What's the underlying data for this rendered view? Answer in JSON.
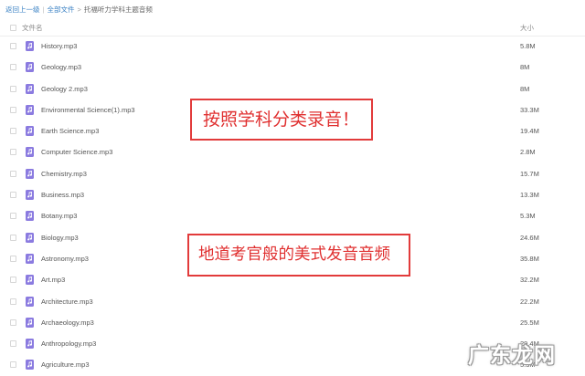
{
  "breadcrumb": {
    "back": "返回上一级",
    "separator": "|",
    "all_files": "全部文件",
    "arrow": ">",
    "current": "托福听力学科主题音频"
  },
  "header": {
    "name_label": "文件名",
    "size_label": "大小"
  },
  "files": [
    {
      "name": "History.mp3",
      "size": "5.8M",
      "icon": "audio-file-icon"
    },
    {
      "name": "Geology.mp3",
      "size": "8M",
      "icon": "audio-file-icon"
    },
    {
      "name": "Geology 2.mp3",
      "size": "8M",
      "icon": "audio-file-icon"
    },
    {
      "name": "Environmental Science(1).mp3",
      "size": "33.3M",
      "icon": "audio-file-icon"
    },
    {
      "name": "Earth Science.mp3",
      "size": "19.4M",
      "icon": "audio-file-icon"
    },
    {
      "name": "Computer Science.mp3",
      "size": "2.8M",
      "icon": "audio-file-icon"
    },
    {
      "name": "Chemistry.mp3",
      "size": "15.7M",
      "icon": "audio-file-icon"
    },
    {
      "name": "Business.mp3",
      "size": "13.3M",
      "icon": "audio-file-icon"
    },
    {
      "name": "Botany.mp3",
      "size": "5.3M",
      "icon": "audio-file-icon"
    },
    {
      "name": "Biology.mp3",
      "size": "24.6M",
      "icon": "audio-file-icon"
    },
    {
      "name": "Astronomy.mp3",
      "size": "35.8M",
      "icon": "audio-file-icon"
    },
    {
      "name": "Art.mp3",
      "size": "32.2M",
      "icon": "audio-file-icon"
    },
    {
      "name": "Architecture.mp3",
      "size": "22.2M",
      "icon": "audio-file-icon"
    },
    {
      "name": "Archaeology.mp3",
      "size": "25.5M",
      "icon": "audio-file-icon"
    },
    {
      "name": "Anthropology.mp3",
      "size": "29.4M",
      "icon": "audio-file-icon"
    },
    {
      "name": "Agriculture.mp3",
      "size": "5.3M",
      "icon": "audio-file-icon"
    }
  ],
  "callouts": {
    "first": "按照学科分类录音！",
    "second": "地道考官般的美式发音音频"
  },
  "watermark": "广东龙网",
  "colors": {
    "link": "#3b82c4",
    "file_icon": "#8b7be0",
    "callout": "#e23b3b"
  }
}
